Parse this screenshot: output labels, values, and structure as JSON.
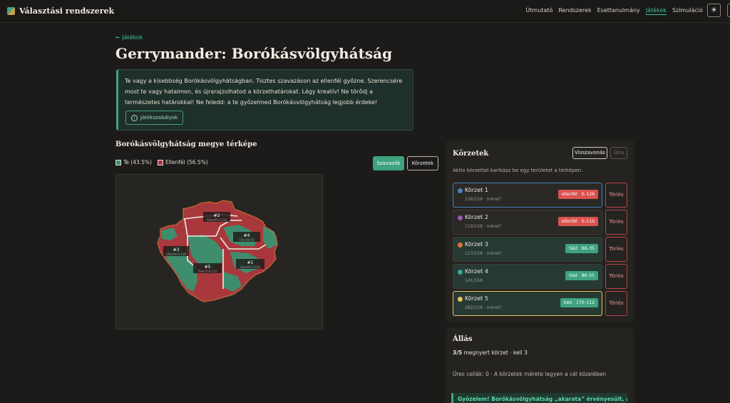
{
  "header": {
    "brand": "Választási rendszerek",
    "nav": [
      "Útmutató",
      "Rendszerek",
      "Esettanulmány",
      "Játékok",
      "Szimuláció"
    ],
    "active_nav": "Játékok",
    "theme_icon": "sun-icon"
  },
  "page": {
    "back_link": "← Játékok",
    "title": "Gerrymander: Borókásvölgyhátság",
    "intro": "Te vagy a kisebbség Borókásvölgyhátságban. Tisztes szavazáson az ellenfél győzne. Szerencsére most te vagy hatalmon, és újrarajzolhatod a körzethatárokat. Légy kreatív! Ne törődj a természetes határokkal! Ne feledd: a te győzelmed Borókásvölgyhátság legjobb érdeke!",
    "rules_button": "Játékszabályok"
  },
  "map": {
    "title": "Borókásvölgyhátság megye térképe",
    "legend_you": "Te (43.5%)",
    "legend_opponent": "Ellenfél (56.5%)",
    "btn_voters": "Szavazók",
    "btn_districts": "Körzetek",
    "labels": [
      {
        "name": "#1",
        "sub": "Ellenfél 0-126"
      },
      {
        "name": "#2",
        "sub": "Ellenfél 0-119"
      },
      {
        "name": "#3",
        "sub": "Ellenfél 0-119"
      },
      {
        "name": "#4",
        "sub": "Tiéd 86-55"
      },
      {
        "name": "#5",
        "sub": "Tiéd 170-112"
      }
    ],
    "colors": {
      "you": "#3e8e6e",
      "opponent": "#a8383c"
    }
  },
  "districts_panel": {
    "title": "Körzetek",
    "undo": "Visszavonás",
    "redo": "Újra",
    "hint": "Aktív körzettel karikázz be egy területet a térképen.",
    "delete_label": "Törlés",
    "items": [
      {
        "name": "Körzet 1",
        "sub": "126/158 · méret?",
        "result": "ellenfél",
        "score": "0–126",
        "color": "#4a7fc1",
        "winner": "opponent"
      },
      {
        "name": "Körzet 2",
        "sub": "119/158 · méret?",
        "result": "ellenfél",
        "score": "0–119",
        "color": "#9b59b6",
        "winner": "opponent"
      },
      {
        "name": "Körzet 3",
        "sub": "123/158 · méret?",
        "result": "tiéd",
        "score": "88–35",
        "color": "#d9773a",
        "winner": "you"
      },
      {
        "name": "Körzet 4",
        "sub": "141/158",
        "result": "tiéd",
        "score": "86–55",
        "color": "#3aa89a",
        "winner": "you"
      },
      {
        "name": "Körzet 5",
        "sub": "282/158 · méret?",
        "result": "tiéd",
        "score": "170–112",
        "color": "#e8c35a",
        "winner": "you"
      }
    ]
  },
  "standing": {
    "title": "Állás",
    "score_bold": "3/5",
    "score_rest": " megnyert körzet · kell 3",
    "empty_cells": "Üres cellák: 0 · A körzetek mérete legyen a cél közelében",
    "win_text": "Győzelem! Borókásvölgyhátság „akarata” érvényesült, a"
  }
}
